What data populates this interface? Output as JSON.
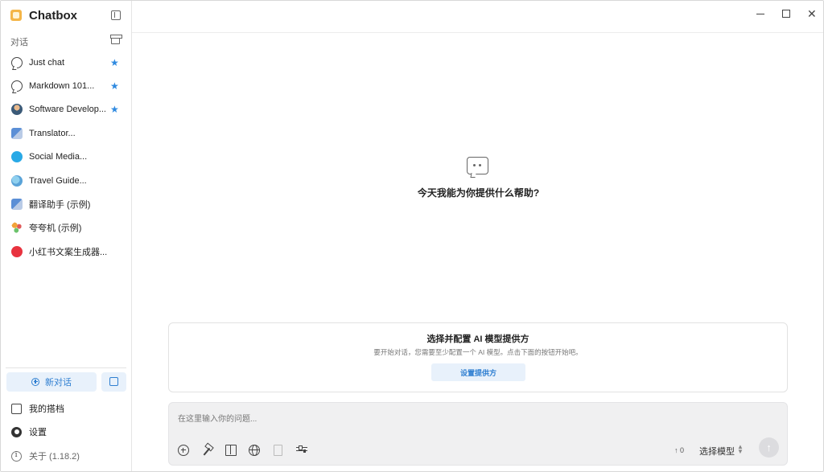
{
  "app": {
    "name": "Chatbox"
  },
  "sidebar": {
    "section_label": "对话",
    "conversations": [
      {
        "label": "Just chat",
        "starred": true,
        "avatar": "chat-bubble-icon"
      },
      {
        "label": "Markdown 101...",
        "starred": true,
        "avatar": "chat-bubble-icon"
      },
      {
        "label": "Software Develop...",
        "starred": true,
        "avatar": "developer-avatar"
      },
      {
        "label": "Translator...",
        "starred": false,
        "avatar": "translator-avatar"
      },
      {
        "label": "Social Media...",
        "starred": false,
        "avatar": "twitter-avatar"
      },
      {
        "label": "Travel Guide...",
        "starred": false,
        "avatar": "globe-avatar"
      },
      {
        "label": "翻译助手 (示例)",
        "starred": false,
        "avatar": "translator-avatar"
      },
      {
        "label": "夸夸机 (示例)",
        "starred": false,
        "avatar": "flower-avatar"
      },
      {
        "label": "小红书文案生成器...",
        "starred": false,
        "avatar": "xiaohongshu-avatar"
      }
    ],
    "new_chat_label": "新对话",
    "my_copilots_label": "我的搭档",
    "settings_label": "设置",
    "about_label": "关于 (1.18.2)"
  },
  "main": {
    "empty_title": "今天我能为你提供什么帮助?",
    "provider_card": {
      "title": "选择并配置 AI 模型提供方",
      "description": "要开始对话，您需要至少配置一个 AI 模型。点击下面的按钮开始吧。",
      "button_label": "设置提供方"
    },
    "input": {
      "placeholder": "在这里输入你的问题...",
      "token_count": "↑ 0",
      "model_select": "选择模型"
    }
  },
  "colors": {
    "accent": "#2f7fd1",
    "star": "#2f8ae0",
    "accent_bg": "#e8f1fb"
  }
}
